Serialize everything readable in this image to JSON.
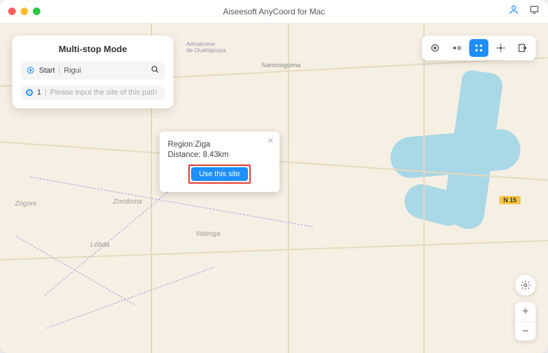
{
  "window": {
    "title": "Aiseesoft AnyCoord for Mac"
  },
  "mode_panel": {
    "title": "Multi-stop Mode",
    "start_label": "Start",
    "start_value": "Rigui",
    "stop_number": "1",
    "stop_placeholder": "Please input the site of this path"
  },
  "popup": {
    "region_label": "Region:",
    "region_value": "Ziga",
    "distance_label": "Distance:",
    "distance_value": "8.43km",
    "button_label": "Use this site"
  },
  "map_labels": {
    "namissiguima": "Namissiguima",
    "zogore": "Zogore",
    "zondoma": "Zondoma",
    "lebda": "Lébda",
    "yatenga": "Yatenga",
    "aerodrome_line1": "Aérodrome",
    "aerodrome_line2": "de Ouahigouya",
    "road_badge": "N 15"
  },
  "icons": {
    "account": "account-icon",
    "fullscreen": "fullscreen-icon",
    "modify_location": "modify-location-icon",
    "one_stop": "one-stop-icon",
    "multi_stop": "multi-stop-icon",
    "joystick": "joystick-icon",
    "export": "export-icon",
    "settings": "settings-icon",
    "zoom_in": "+",
    "zoom_out": "−"
  }
}
